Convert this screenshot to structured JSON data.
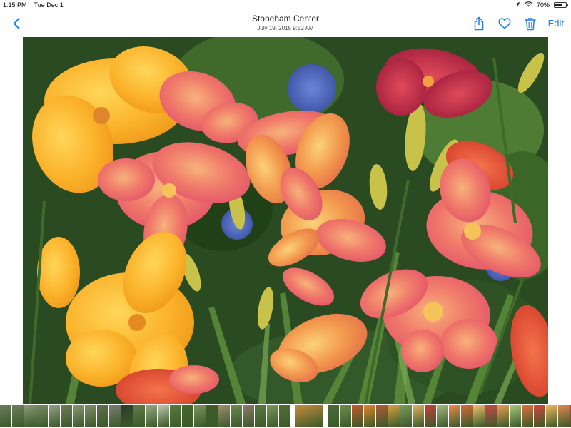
{
  "status": {
    "time": "1:15 PM",
    "date": "Tue Dec 1",
    "battery": "70%",
    "battery_level": 0.7
  },
  "nav": {
    "title": "Stoneham Center",
    "subtitle": "July 19, 2015  9:52 AM",
    "edit_label": "Edit"
  },
  "icons": {
    "back": "chevron-left-icon",
    "share": "share-icon",
    "favorite": "heart-icon",
    "delete": "trash-icon"
  },
  "colors": {
    "accent": "#1a7df2",
    "background": "#ffffff"
  },
  "photo": {
    "subject": "daylily garden"
  },
  "thumbnails": [
    "#6a7b5a",
    "#6f7d5e",
    "#8e9a78",
    "#7a8a66",
    "#95a183",
    "#6d7c58",
    "#8a9673",
    "#7f8d68",
    "#5f6e4d",
    "#7a7c70",
    "#2c3a28",
    "#627a4a",
    "#9aa882",
    "#c0c4b0",
    "#5a7a3e",
    "#456a30",
    "#7d9460",
    "#3e5c2c",
    "#a08e70",
    "#6a8a52",
    "#8e7a6a",
    "#587a40",
    "#7a9a58",
    "#4e7036",
    "#c88a3a",
    "#4a6a38",
    "#6e8e4e",
    "#c25a2e",
    "#e0862a",
    "#b05a3a",
    "#d9a040",
    "#7a9a5a",
    "#e4b060",
    "#c8403a",
    "#a6b880",
    "#e88a4a",
    "#d66a3a",
    "#f0c070",
    "#c84a4a",
    "#e8a050",
    "#a8c880",
    "#e07040",
    "#d04a3a",
    "#f2b860",
    "#e08a50",
    "#c83a3a",
    "#e86a4a",
    "#d8a060",
    "#b83a3a",
    "#e09050",
    "#c8603a"
  ],
  "current_thumb_index": 24
}
